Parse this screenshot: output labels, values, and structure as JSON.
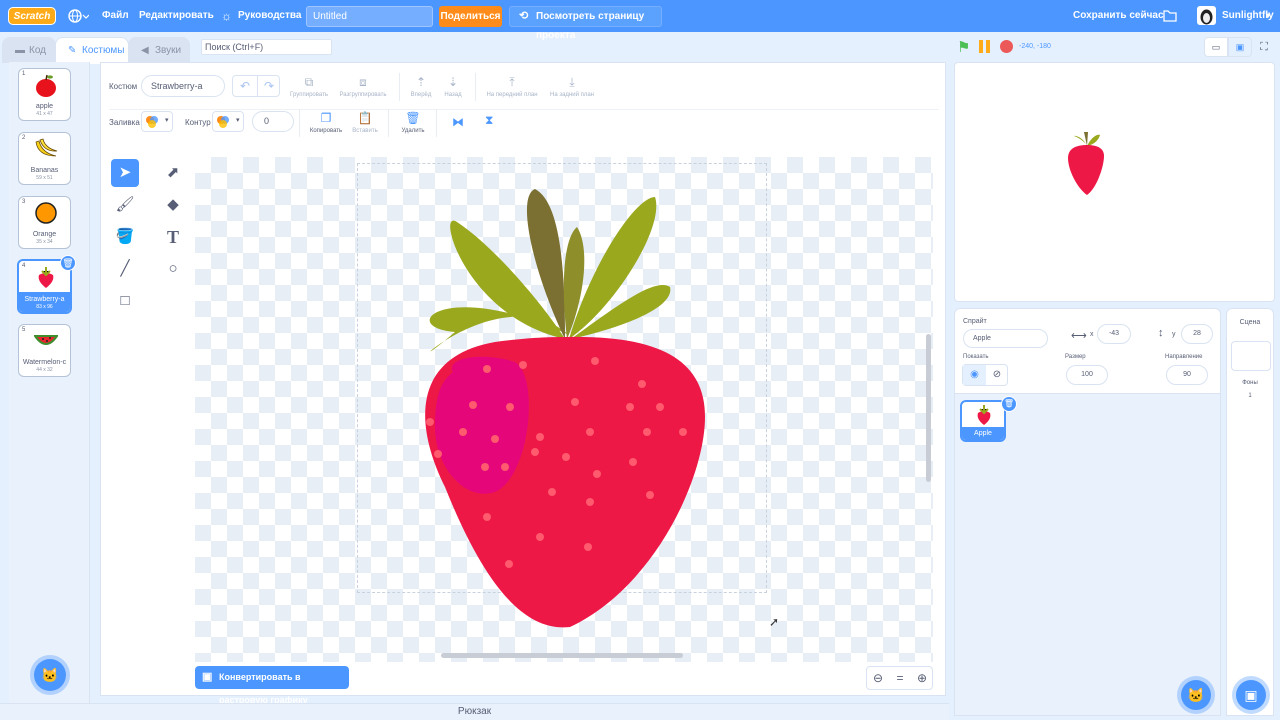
{
  "menubar": {
    "logo": "Scratch",
    "file": "Файл",
    "edit": "Редактировать",
    "tutorials": "Руководства",
    "project_title": "Untitled",
    "share": "Поделиться",
    "see_project_page": "Посмотреть страницу проекта",
    "save_now": "Сохранить сейчас",
    "username": "Sunlightfly"
  },
  "tabs": {
    "code": "Код",
    "costumes": "Костюмы",
    "sounds": "Звуки"
  },
  "search": {
    "placeholder": "Поиск (Ctrl+F)"
  },
  "costumes": [
    {
      "num": "1",
      "name": "apple",
      "size": "41 x 47"
    },
    {
      "num": "2",
      "name": "Bananas",
      "size": "59 x 51"
    },
    {
      "num": "3",
      "name": "Orange",
      "size": "35 x 34"
    },
    {
      "num": "4",
      "name": "Strawberry-a",
      "size": "83 x 96"
    },
    {
      "num": "5",
      "name": "Watermelon-c",
      "size": "44 x 32"
    }
  ],
  "editor": {
    "costume_label": "Костюм",
    "costume_name": "Strawberry-a",
    "group": "Группировать",
    "ungroup": "Разгруппировать",
    "forward": "Вперёд",
    "backward": "Назад",
    "front": "На передний план",
    "back": "На задний план",
    "fill_label": "Заливка",
    "outline_label": "Контур",
    "outline_width": "0",
    "copy": "Копировать",
    "paste": "Вставить",
    "delete": "Удалить",
    "convert_bitmap": "Конвертировать в растровую графику"
  },
  "stage_controls": {
    "coords": "-240, -180"
  },
  "sprite_info": {
    "sprite_label": "Спрайт",
    "sprite_name": "Apple",
    "x_label": "x",
    "x_value": "-43",
    "y_label": "y",
    "y_value": "28",
    "show_label": "Показать",
    "size_label": "Размер",
    "size_value": "100",
    "direction_label": "Направление",
    "direction_value": "90"
  },
  "sprites": [
    {
      "name": "Apple"
    }
  ],
  "stage_pane": {
    "title": "Сцена",
    "backdrops_label": "Фоны",
    "backdrops_count": "1"
  },
  "backpack": "Рюкзак",
  "colors": {
    "accent": "#4c97ff",
    "share": "#ff8c1a",
    "strawberry": "#ee1846",
    "leaf": "#9aa81e"
  }
}
